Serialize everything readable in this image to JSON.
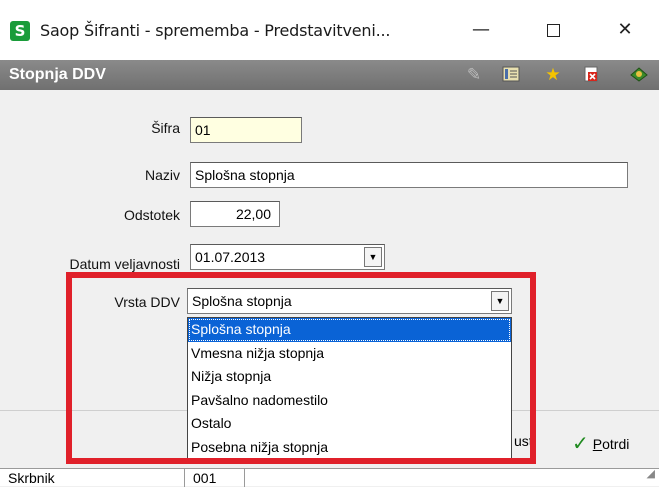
{
  "window": {
    "icon_letter": "S",
    "title": "Saop Šifranti - sprememba - Predstavitveni...",
    "minimize": "—",
    "close": "✕"
  },
  "header": {
    "title": "Stopnja DDV"
  },
  "form": {
    "sifra_label": "Šifra",
    "sifra_value": "01",
    "naziv_label": "Naziv",
    "naziv_value": "Splošna stopnja",
    "odstotek_label": "Odstotek",
    "odstotek_value": "22,00",
    "datum_label": "Datum veljavnosti",
    "datum_value": "01.07.2013",
    "vrsta_label": "Vrsta DDV",
    "vrsta_value": "Splošna stopnja"
  },
  "dropdown": {
    "options": [
      "Splošna stopnja",
      "Vmesna nižja stopnja",
      "Nižja stopnja",
      "Pavšalno nadomestilo",
      "Ostalo",
      "Posebna nižja stopnja"
    ],
    "selected_index": 0
  },
  "buttons": {
    "cancel_partial": "usti",
    "confirm_first": "P",
    "confirm_rest": "otrdi"
  },
  "status": {
    "skrbnik_label": "Skrbnik",
    "skrbnik_value": "001"
  },
  "colors": {
    "highlight": "#e0202a",
    "selection": "#0a63d6",
    "header_bg": "#7c7c7c"
  }
}
